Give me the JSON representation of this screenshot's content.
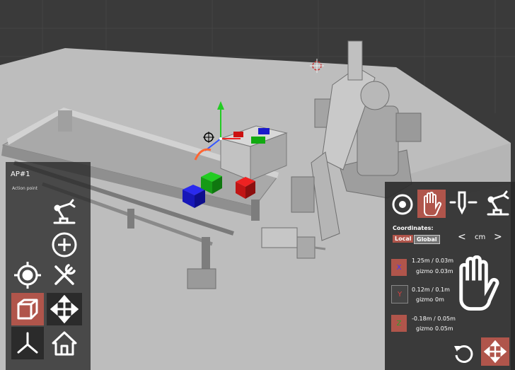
{
  "left_panel": {
    "title": "AP#1",
    "subtitle": "Action point",
    "buttons": [
      {
        "icon": "robot-arm-icon"
      },
      {
        "icon": "add-circle-icon"
      },
      {
        "icon": "target-icon"
      },
      {
        "icon": "tools-icon"
      },
      {
        "icon": "cube-icon",
        "active": true
      },
      {
        "icon": "move-arrows-icon"
      },
      {
        "icon": "axes-icon"
      },
      {
        "icon": "home-icon"
      }
    ]
  },
  "right_panel": {
    "tool_icons": [
      "target-ring-icon",
      "hand-icon",
      "pointer-tool-icon",
      "robot-arm-icon"
    ],
    "coordinates_label": "Coordinates:",
    "local_label": "Local",
    "global_label": "Global",
    "unit_prev": "<",
    "unit": "cm",
    "unit_next": ">",
    "axes": [
      {
        "axis": "X",
        "value": "1.25m / 0.03m",
        "gizmo_label": "gizmo",
        "gizmo_value": "0.03m"
      },
      {
        "axis": "Y",
        "value": "0.12m / 0.1m",
        "gizmo_label": "gizmo",
        "gizmo_value": "0m"
      },
      {
        "axis": "Z",
        "value": "-0.18m / 0.05m",
        "gizmo_label": "gizmo",
        "gizmo_value": "0.05m"
      }
    ]
  },
  "colors": {
    "accent": "#b0554b",
    "panel": "#2a2a2a",
    "floor": "#bdbdbd",
    "background": "#3a3a3a"
  }
}
